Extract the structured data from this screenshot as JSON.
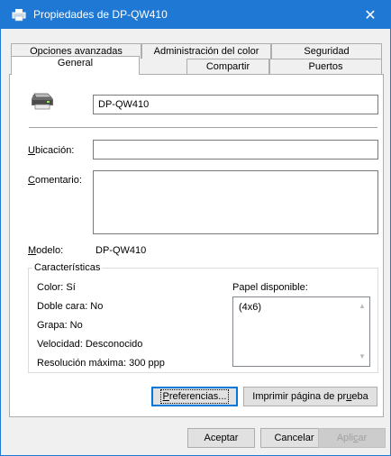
{
  "window": {
    "title": "Propiedades de DP-QW410",
    "close_glyph": "✕",
    "accent": "#1e78d4"
  },
  "tabs": {
    "row_back": [
      "Opciones avanzadas",
      "Administración del color",
      "Seguridad"
    ],
    "row_front": [
      "General",
      "Compartir",
      "Puertos"
    ],
    "selected": "General"
  },
  "general": {
    "printer_name": "DP-QW410",
    "location_prefix": "U",
    "location_rest": "bicación:",
    "location_value": "",
    "comment_prefix": "C",
    "comment_rest": "omentario:",
    "comment_value": "",
    "model_label_prefix": "M",
    "model_label_rest": "odelo:",
    "model_value": "DP-QW410"
  },
  "features": {
    "title": "Características",
    "color": "Color: Sí",
    "duplex": "Doble cara: No",
    "staple": "Grapa: No",
    "speed": "Velocidad: Desconocido",
    "resolution": "Resolución máxima: 300 ppp",
    "paper_label": "Papel disponible:",
    "paper_items": [
      "(4x6)"
    ]
  },
  "buttons": {
    "preferences_prefix": "P",
    "preferences_rest": "referencias...",
    "test_page_a": "Imprimir página de pr",
    "test_page_u": "u",
    "test_page_b": "eba",
    "ok": "Aceptar",
    "cancel": "Cancelar",
    "apply_a": "Apli",
    "apply_u": "c",
    "apply_b": "ar"
  }
}
